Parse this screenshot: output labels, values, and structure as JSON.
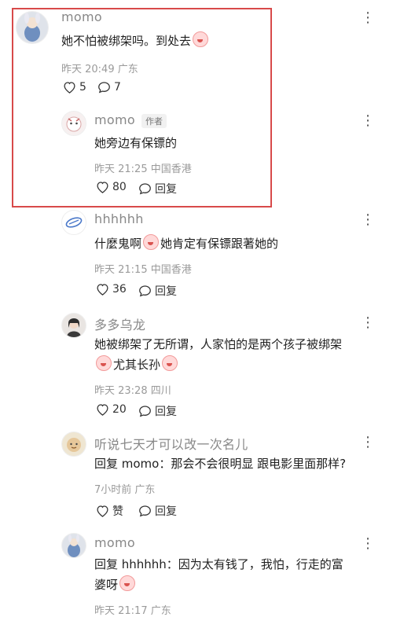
{
  "comments": [
    {
      "name": "momo",
      "text": "她不怕被绑架吗。到处去",
      "time": "昨天 20:49 广东",
      "likes": "5",
      "replies": "7"
    },
    {
      "name": "momo",
      "badge": "作者",
      "text": "她旁边有保镖的",
      "time": "昨天 21:25 中国香港",
      "likes": "80",
      "reply_label": "回复"
    },
    {
      "name": "hhhhhh",
      "text_a": "什麼鬼啊",
      "text_b": "她肯定有保镖跟著她的",
      "time": "昨天 21:15 中国香港",
      "likes": "36",
      "reply_label": "回复"
    },
    {
      "name": "多多乌龙",
      "line1": "她被绑架了无所谓，人家怕的是两个孩子被绑架",
      "line2": "尤其长孙",
      "time": "昨天 23:28 四川",
      "likes": "20",
      "reply_label": "回复"
    },
    {
      "name": "听说七天才可以改一次名儿",
      "text": "回复 momo：那会不会很明显 跟电影里面那样?",
      "time": "7小时前 广东",
      "like_label": "赞",
      "reply_label": "回复"
    },
    {
      "name": "momo",
      "line1": "回复 hhhhhh：因为太有钱了，我怕，行走的富",
      "line2": "婆呀",
      "time": "昨天 21:17 广东"
    }
  ],
  "highlight_color": "#d84a4a"
}
